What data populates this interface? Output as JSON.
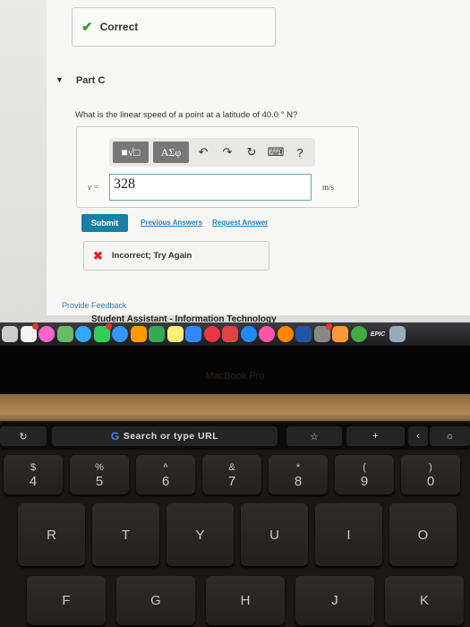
{
  "feedback_correct": {
    "icon": "check-icon",
    "text": "Correct"
  },
  "part": {
    "label": "Part C"
  },
  "question": "What is the linear speed of a point at a latitude of 40.0 ° N?",
  "toolbar": {
    "templates": "■√□",
    "greek": "ΑΣφ",
    "undo": "↶",
    "redo": "↷",
    "reset": "↻",
    "keyboard": "⌨",
    "help": "?"
  },
  "answer": {
    "variable": "v =",
    "value": "328",
    "unit": "m/s"
  },
  "buttons": {
    "submit": "Submit",
    "previous": "Previous Answers",
    "request": "Request Answer"
  },
  "feedback_incorrect": {
    "icon": "x-icon",
    "text": "Incorrect; Try Again"
  },
  "provide_feedback": "Provide Feedback",
  "behind_text": "Student Assistant - Information Technology",
  "dock": {
    "apps": [
      "contacts",
      "reminders",
      "photos",
      "maps",
      "messages",
      "facetime",
      "safari",
      "pages",
      "numbers",
      "notes",
      "keynote",
      "news",
      "powerpoint",
      "app-store",
      "itunes",
      "books",
      "word",
      "system-preferences",
      "microsoft-store",
      "chrome",
      "epic-games",
      "preview"
    ],
    "epic_label": "EPIC"
  },
  "laptop": {
    "brand": "MacBook Pro"
  },
  "touchbar": {
    "reload": "↻",
    "search": "Search or type URL",
    "google": "G",
    "bookmark": "☆",
    "add": "+",
    "back": "‹",
    "brightness": "☼"
  },
  "keys": {
    "row1": [
      {
        "top": "$",
        "main": "4"
      },
      {
        "top": "%",
        "main": "5"
      },
      {
        "top": "^",
        "main": "6"
      },
      {
        "top": "&",
        "main": "7"
      },
      {
        "top": "*",
        "main": "8"
      },
      {
        "top": "(",
        "main": "9"
      },
      {
        "top": ")",
        "main": "0"
      }
    ],
    "row2": [
      "R",
      "T",
      "Y",
      "U",
      "I",
      "O"
    ],
    "row3": [
      "F",
      "G",
      "H",
      "J",
      "K"
    ]
  },
  "colors": {
    "accent": "#1a7fa4",
    "link": "#2a7fb8",
    "correct": "#3a9a3a",
    "incorrect": "#dd2233"
  }
}
